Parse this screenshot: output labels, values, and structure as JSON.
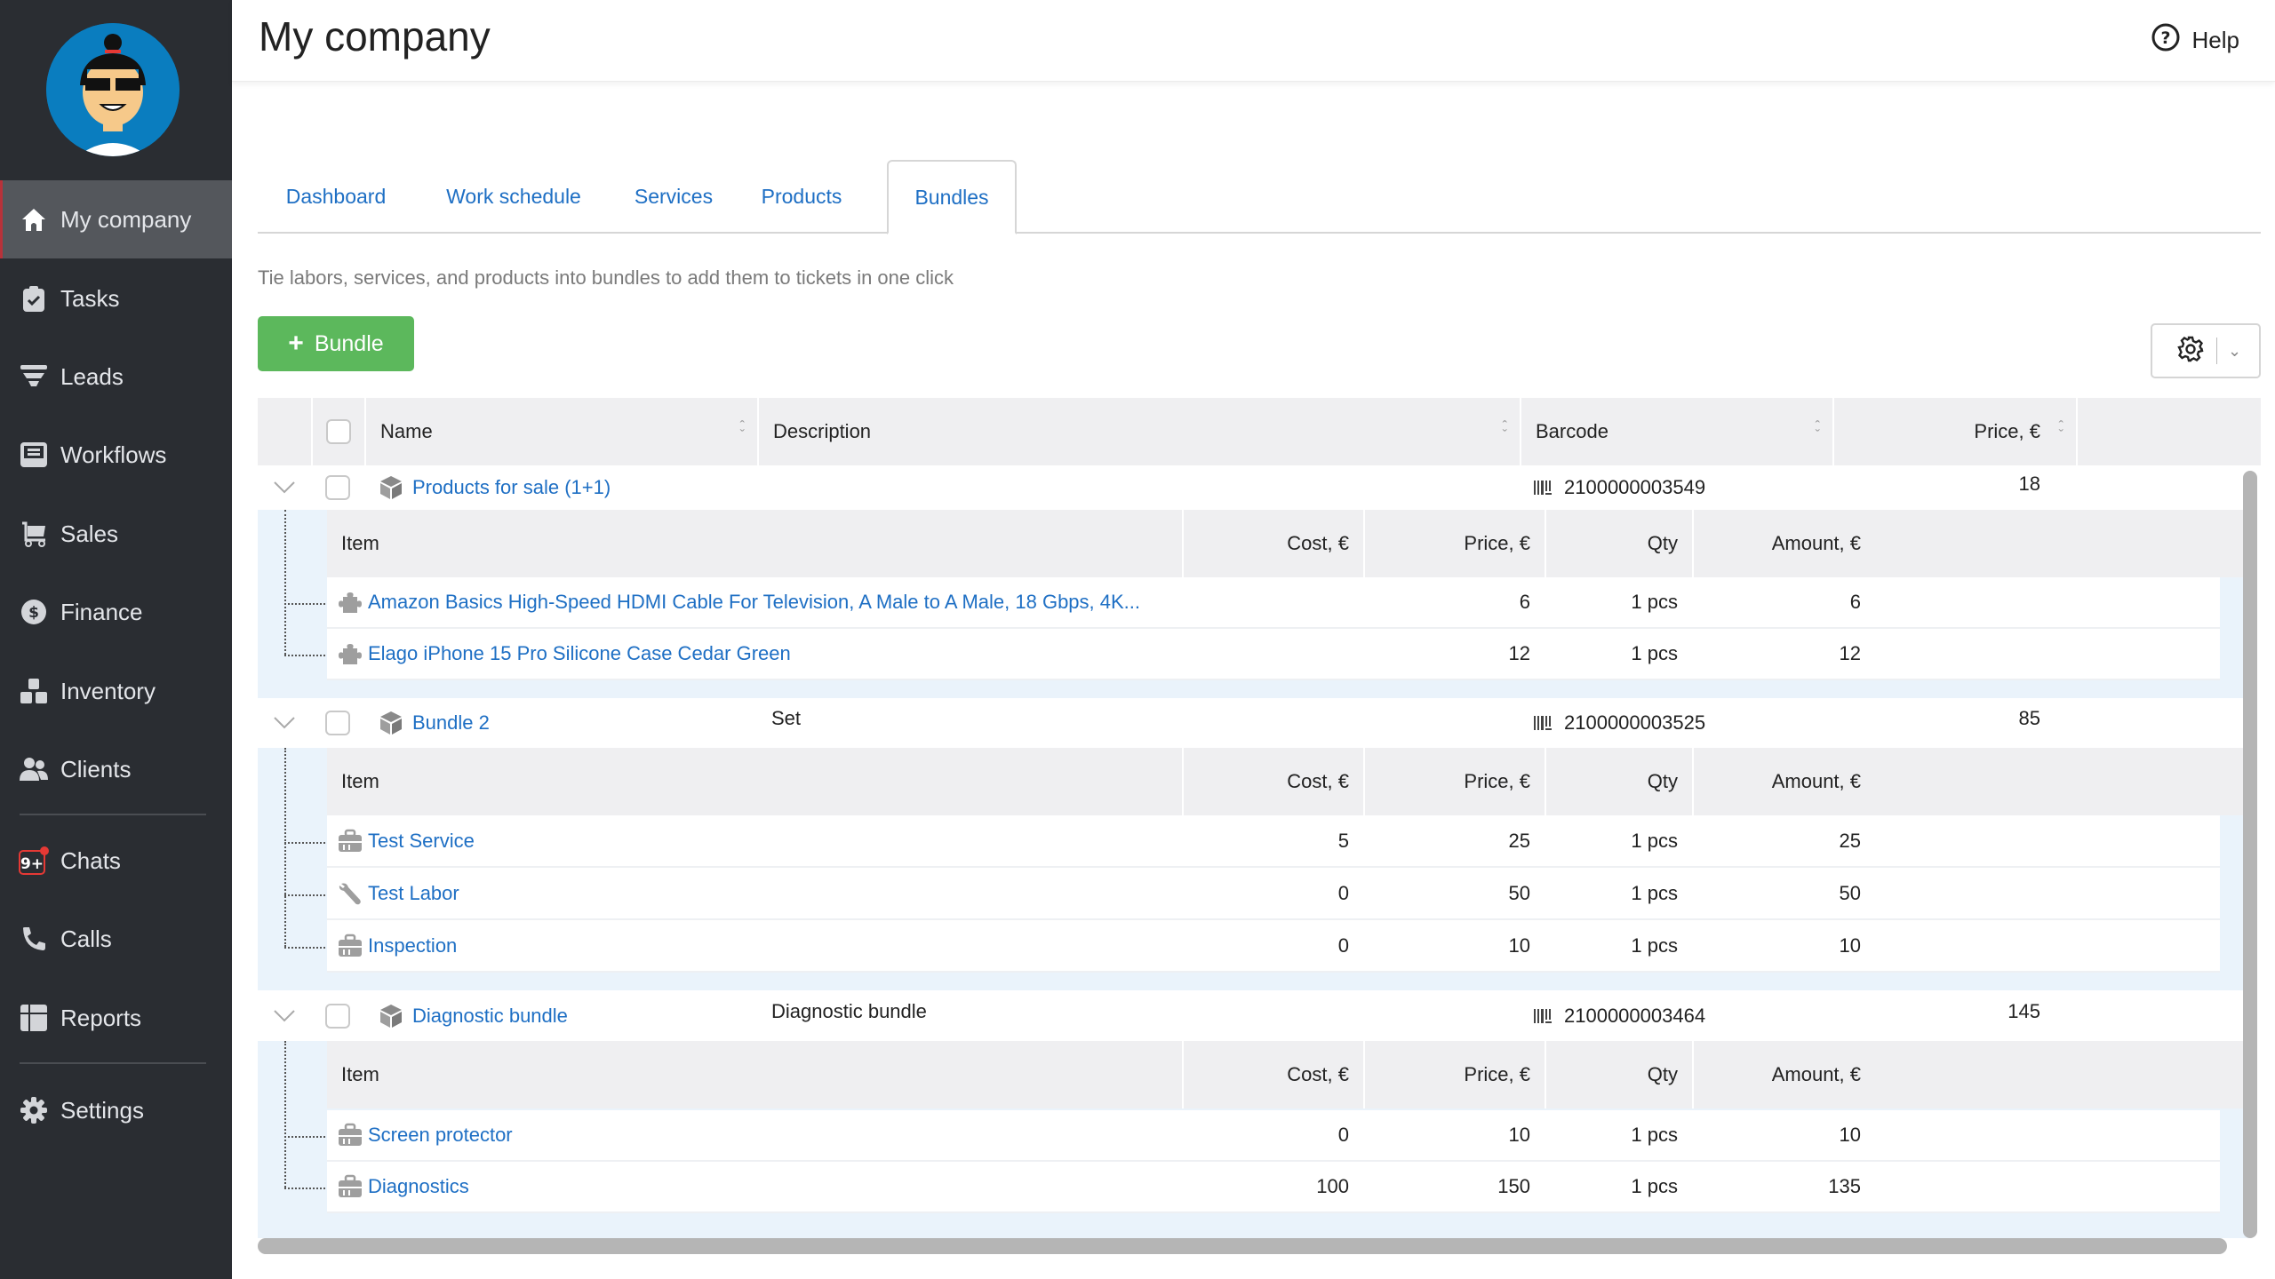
{
  "sidebar": {
    "items": [
      {
        "label": "My company",
        "icon": "home-icon",
        "active": true
      },
      {
        "label": "Tasks",
        "icon": "clipboard-check-icon"
      },
      {
        "label": "Leads",
        "icon": "funnel-icon"
      },
      {
        "label": "Workflows",
        "icon": "inbox-icon"
      },
      {
        "label": "Sales",
        "icon": "cart-icon"
      },
      {
        "label": "Finance",
        "icon": "dollar-circle-icon"
      },
      {
        "label": "Inventory",
        "icon": "boxes-icon"
      },
      {
        "label": "Clients",
        "icon": "users-icon"
      },
      {
        "label": "Chats",
        "icon": "chat-badge-icon",
        "badge": "9+"
      },
      {
        "label": "Calls",
        "icon": "phone-icon"
      },
      {
        "label": "Reports",
        "icon": "table-icon"
      },
      {
        "label": "Settings",
        "icon": "gear-icon"
      }
    ]
  },
  "header": {
    "title": "My company",
    "help_label": "Help"
  },
  "tabs": [
    {
      "label": "Dashboard"
    },
    {
      "label": "Work schedule"
    },
    {
      "label": "Services"
    },
    {
      "label": "Products"
    },
    {
      "label": "Bundles",
      "active": true
    }
  ],
  "hint": "Tie labors, services, and products into bundles to add them to tickets in one click",
  "toolbar": {
    "add_bundle_label": "Bundle",
    "add_bundle_icon": "plus-icon",
    "settings_icon": "gear-icon"
  },
  "colors": {
    "accent": "#1e6fc4",
    "primary_button": "#5cb85c",
    "sidebar_bg": "#2a2d32",
    "sidebar_active": "#54575c",
    "badge": "#e53935"
  },
  "table": {
    "columns": [
      "Name",
      "Description",
      "Barcode",
      "Price, €"
    ],
    "sub_columns": [
      "Item",
      "Cost, €",
      "Price, €",
      "Qty",
      "Amount, €"
    ],
    "bundles": [
      {
        "name": "Products for sale (1+1)",
        "description": "",
        "barcode": "2100000003549",
        "price": "18",
        "items": [
          {
            "icon": "puzzle-icon",
            "name": "Amazon Basics High-Speed HDMI Cable For Television, A Male to A Male, 18 Gbps, 4K...",
            "cost": "",
            "price": "6",
            "qty": "1 pcs",
            "amount": "6"
          },
          {
            "icon": "puzzle-icon",
            "name": "Elago iPhone 15 Pro Silicone Case Cedar Green",
            "cost": "",
            "price": "12",
            "qty": "1 pcs",
            "amount": "12"
          }
        ]
      },
      {
        "name": "Bundle 2",
        "description": "Set",
        "barcode": "2100000003525",
        "price": "85",
        "items": [
          {
            "icon": "briefcase-icon",
            "name": "Test Service",
            "cost": "5",
            "price": "25",
            "qty": "1 pcs",
            "amount": "25"
          },
          {
            "icon": "wrench-icon",
            "name": "Test Labor",
            "cost": "0",
            "price": "50",
            "qty": "1 pcs",
            "amount": "50"
          },
          {
            "icon": "briefcase-icon",
            "name": "Inspection",
            "cost": "0",
            "price": "10",
            "qty": "1 pcs",
            "amount": "10"
          }
        ]
      },
      {
        "name": "Diagnostic bundle",
        "description": "Diagnostic bundle",
        "barcode": "2100000003464",
        "price": "145",
        "items": [
          {
            "icon": "briefcase-icon",
            "name": "Screen protector",
            "cost": "0",
            "price": "10",
            "qty": "1 pcs",
            "amount": "10"
          },
          {
            "icon": "briefcase-icon",
            "name": "Diagnostics",
            "cost": "100",
            "price": "150",
            "qty": "1 pcs",
            "amount": "135"
          }
        ]
      }
    ]
  }
}
